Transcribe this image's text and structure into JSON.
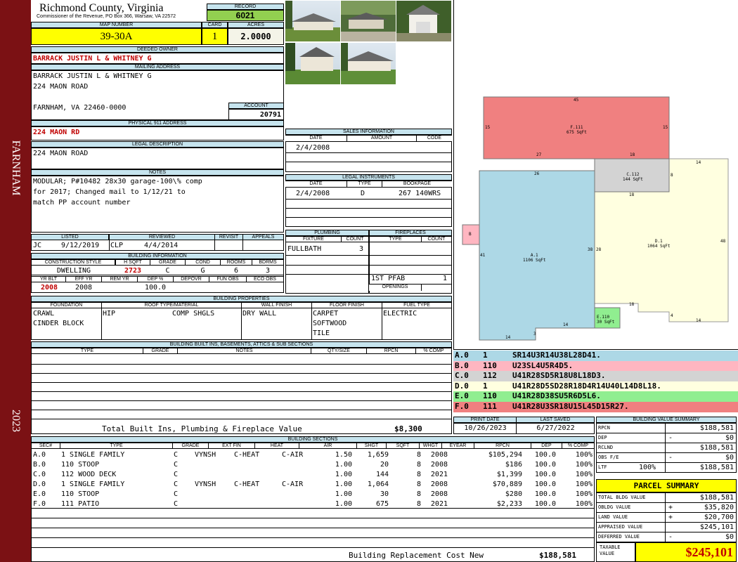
{
  "sidebar": {
    "city": "FARNHAM",
    "year": "2023"
  },
  "header": {
    "county": "Richmond County, Virginia",
    "commissioner": "Commissioner of the Revenue, PO Box 366, Warsaw, VA 22572",
    "record_label": "RECORD",
    "record": "6021",
    "map_number_label": "MAP NUMBER",
    "map_number": "39-30A",
    "card_label": "CARD",
    "card": "1",
    "acres_label": "ACRES",
    "acres": "2.0000"
  },
  "owner": {
    "deeded_label": "DEEDED OWNER",
    "deeded": "BARRACK JUSTIN L & WHITNEY G",
    "mailing_label": "MAILING ADDRESS",
    "mailing": [
      "BARRACK JUSTIN L & WHITNEY G",
      "224 MAON ROAD",
      "",
      "FARNHAM, VA 22460-0000"
    ],
    "account_label": "ACCOUNT",
    "account": "20791"
  },
  "physical": {
    "label": "PHYSICAL 911 ADDRESS",
    "value": "224 MAON RD"
  },
  "legal": {
    "label": "LEGAL DESCRIPTION",
    "value": "224 MAON ROAD"
  },
  "notes": {
    "label": "NOTES",
    "lines": [
      "MODULAR; P#10482 28x30 garage-100\\% comp",
      "for 2017; Changed mail to 1/12/21 to",
      "match PP account number"
    ]
  },
  "sales": {
    "label": "SALES INFORMATION",
    "cols": [
      "DATE",
      "AMOUNT",
      "CODE"
    ],
    "rows": [
      {
        "date": "2/4/2008",
        "amount": "",
        "code": ""
      }
    ]
  },
  "instruments": {
    "label": "LEGAL INSTRUMENTS",
    "cols": [
      "DATE",
      "TYPE",
      "BOOKPAGE"
    ],
    "rows": [
      {
        "date": "2/4/2008",
        "type": "D",
        "book": "267 140WRS"
      }
    ]
  },
  "review": {
    "cols": [
      "LISTED",
      "REVIEWED",
      "REVISIT",
      "APPEALS"
    ],
    "listed_by": "JC",
    "listed_date": "9/12/2019",
    "reviewed_by": "CLP",
    "reviewed_date": "4/4/2014"
  },
  "building_info": {
    "label": "BUILDING INFORMATION",
    "cols1": [
      "CONSTRUCTION STYLE",
      "H SQFT",
      "GRADE",
      "COND",
      "ROOMS",
      "BDRMS"
    ],
    "style": "DWELLING",
    "hsqft": "2723",
    "grade": "C",
    "cond": "G",
    "rooms": "6",
    "bdrms": "3",
    "cols2": [
      "YR BLT",
      "EFF YR",
      "REM YR",
      "DEP %",
      "DEPOVR",
      "FUN OBS",
      "ECO OBS"
    ],
    "yr_blt": "2008",
    "eff_yr": "2008",
    "rem_yr": "",
    "dep": "100.0"
  },
  "plumbing": {
    "label": "PLUMBING",
    "cols": [
      "FIXTURE",
      "COUNT"
    ],
    "fixture": "FULLBATH",
    "count": "3"
  },
  "fireplaces": {
    "label": "FIREPLACES",
    "cols": [
      "TYPE",
      "COUNT"
    ],
    "type": "1ST PFAB",
    "count": "1",
    "openings_label": "OPENINGS"
  },
  "properties": {
    "label": "BUILDING PROPERTIES",
    "cols": [
      "FOUNDATION",
      "ROOF TYPE/MATERIAL",
      "WALL FINISH",
      "FLOOR FINISH",
      "FUEL TYPE"
    ],
    "foundation": [
      "CRAWL",
      "CINDER BLOCK"
    ],
    "roof_type": "HIP",
    "roof_material": "COMP SHGLS",
    "wall": "DRY WALL",
    "floor": [
      "CARPET",
      "SOFTWOOD",
      "TILE"
    ],
    "fuel": "ELECTRIC"
  },
  "builtins": {
    "label": "BUILDING BUILT INS, BASEMENTS, ATTICS & SUB SECTIONS",
    "cols": [
      "TYPE",
      "GRADE",
      "NOTES",
      "QTY/SIZE",
      "RPCN",
      "% COMP"
    ],
    "total_label": "Total Built Ins, Plumbing & Fireplace Value",
    "total": "$8,300"
  },
  "sections": {
    "label": "BUILDING SECTIONS",
    "cols": [
      "SEC#",
      "TYPE",
      "GRADE",
      "EXT FIN",
      "HEAT",
      "AIR",
      "SHGT",
      "SQFT",
      "WHGT",
      "EYEAR",
      "RPCN",
      "DEP",
      "% COMP"
    ],
    "rows": [
      {
        "sec": "A.0",
        "type": "1 SINGLE FAMILY",
        "grade": "C",
        "ext": "VYNSH",
        "heat": "C-HEAT",
        "air": "C-AIR",
        "shgt": "1.50",
        "sqft": "1,659",
        "whgt": "8",
        "eyear": "2008",
        "rpcn": "$105,294",
        "dep": "100.0",
        "comp": "100%"
      },
      {
        "sec": "B.0",
        "type": "110 STOOP",
        "grade": "C",
        "ext": "",
        "heat": "",
        "air": "",
        "shgt": "1.00",
        "sqft": "20",
        "whgt": "8",
        "eyear": "2008",
        "rpcn": "$186",
        "dep": "100.0",
        "comp": "100%"
      },
      {
        "sec": "C.0",
        "type": "112 WOOD DECK",
        "grade": "C",
        "ext": "",
        "heat": "",
        "air": "",
        "shgt": "1.00",
        "sqft": "144",
        "whgt": "8",
        "eyear": "2021",
        "rpcn": "$1,399",
        "dep": "100.0",
        "comp": "100%"
      },
      {
        "sec": "D.0",
        "type": "1 SINGLE FAMILY",
        "grade": "C",
        "ext": "VYNSH",
        "heat": "C-HEAT",
        "air": "C-AIR",
        "shgt": "1.00",
        "sqft": "1,064",
        "whgt": "8",
        "eyear": "2008",
        "rpcn": "$70,889",
        "dep": "100.0",
        "comp": "100%"
      },
      {
        "sec": "E.0",
        "type": "110 STOOP",
        "grade": "C",
        "ext": "",
        "heat": "",
        "air": "",
        "shgt": "1.00",
        "sqft": "30",
        "whgt": "8",
        "eyear": "2008",
        "rpcn": "$280",
        "dep": "100.0",
        "comp": "100%"
      },
      {
        "sec": "F.0",
        "type": "111 PATIO",
        "grade": "C",
        "ext": "",
        "heat": "",
        "air": "",
        "shgt": "1.00",
        "sqft": "675",
        "whgt": "8",
        "eyear": "2021",
        "rpcn": "$2,233",
        "dep": "100.0",
        "comp": "100%"
      }
    ],
    "replacement_label": "Building Replacement Cost New",
    "replacement": "$188,581"
  },
  "sketch": {
    "areas": [
      {
        "id": "A",
        "label": "A.1",
        "sqft": "1106 SqFt",
        "color": "#add8e6"
      },
      {
        "id": "B",
        "label": "B",
        "color": "#ffb6c1"
      },
      {
        "id": "C",
        "label": "C.112",
        "sqft": "144 SqFt",
        "color": "#d3d3d3"
      },
      {
        "id": "D",
        "label": "D.1",
        "sqft": "1064 SqFt",
        "color": "#ffffe0"
      },
      {
        "id": "E",
        "label": "E.110",
        "sqft": "30 SqFt",
        "color": "#90ee90"
      },
      {
        "id": "F",
        "label": "F.111",
        "sqft": "675 SqFt",
        "color": "#f08080"
      }
    ],
    "dims": [
      "45",
      "15",
      "15",
      "27",
      "18",
      "26",
      "8",
      "14",
      "18",
      "41",
      "38",
      "28",
      "48",
      "18",
      "4",
      "14",
      "14",
      "3",
      "14"
    ]
  },
  "legend": [
    {
      "sec": "A.0",
      "code": "1",
      "path": "SR14U3R14U38L28D41.",
      "color": "#add8e6"
    },
    {
      "sec": "B.0",
      "code": "110",
      "path": "U23SL4U5R4D5.",
      "color": "#ffb6c1"
    },
    {
      "sec": "C.0",
      "code": "112",
      "path": "U41R28SD5R18U8L18D3.",
      "color": "#d3d3d3"
    },
    {
      "sec": "D.0",
      "code": "1",
      "path": "U41R28D5SD28R18D4R14U40L14D8L18.",
      "color": "#ffffe0"
    },
    {
      "sec": "E.0",
      "code": "110",
      "path": "U41R28D38SU5R6D5L6.",
      "color": "#90ee90"
    },
    {
      "sec": "F.0",
      "code": "111",
      "path": "U41R28U3SR18U15L45D15R27.",
      "color": "#f08080"
    }
  ],
  "print_info": {
    "print_label": "PRINT DATE",
    "print_date": "10/26/2023",
    "saved_label": "LAST SAVED",
    "saved_date": "6/27/2022"
  },
  "value_summary": {
    "label": "BUILDING VALUE SUMMARY",
    "rows": [
      {
        "k": "RPCN",
        "op": "",
        "v": "$188,581"
      },
      {
        "k": "DEP",
        "op": "-",
        "v": "$0"
      },
      {
        "k": "RCLND",
        "op": "",
        "v": "$188,581"
      },
      {
        "k": "OBS F/E",
        "op": "-",
        "v": "$0"
      },
      {
        "k": "LTF",
        "op": "100%",
        "v": "$188,581"
      }
    ]
  },
  "parcel": {
    "label": "PARCEL SUMMARY",
    "rows": [
      {
        "k": "TOTAL BLDG VALUE",
        "op": "",
        "v": "$188,581"
      },
      {
        "k": "OBLDG VALUE",
        "op": "+",
        "v": "$35,820"
      },
      {
        "k": "LAND VALUE",
        "op": "+",
        "v": "$20,700"
      },
      {
        "k": "APPRAISED VALUE",
        "op": "",
        "v": "$245,101"
      },
      {
        "k": "DEFERRED VALUE",
        "op": "-",
        "v": "$0"
      }
    ],
    "taxable_label": "TAXABLE VALUE",
    "taxable": "$245,101"
  }
}
